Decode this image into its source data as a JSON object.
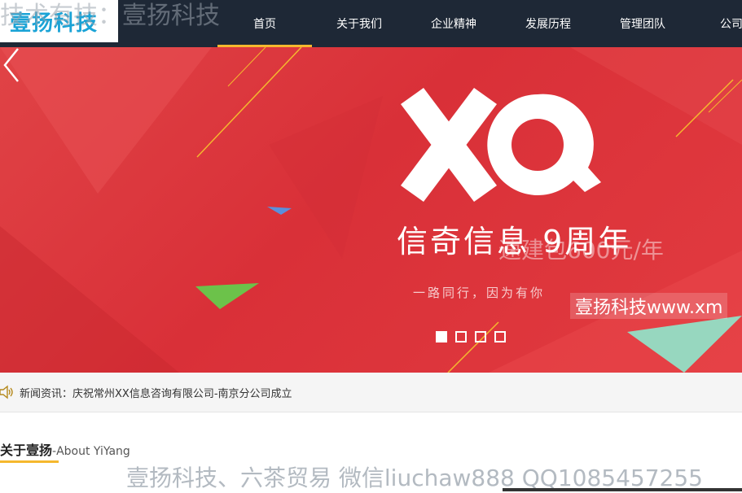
{
  "watermark": {
    "top": "技术有技：壹扬科技",
    "banner": "壹扬科技www.xm",
    "bottom": "壹扬科技、六茶贸易 微信liuchaw888 QQ1085457255"
  },
  "logo": {
    "text": "壹扬科技",
    "color": "#1aa3d6"
  },
  "nav": {
    "items": [
      {
        "label": "首页",
        "active": true
      },
      {
        "label": "关于我们"
      },
      {
        "label": "企业精神"
      },
      {
        "label": "发展历程"
      },
      {
        "label": "管理团队"
      },
      {
        "label": "公司动"
      }
    ]
  },
  "banner": {
    "brand": "XQ",
    "slogan": "信奇信息 9周年",
    "ghost_text": "速建包600元/年",
    "subline": "一路同行，因为有你",
    "dots": 4,
    "active_dot": 0
  },
  "news": {
    "label": "新闻资讯：",
    "text": "庆祝常州XX信息咨询有限公司-南京分公司成立"
  },
  "about": {
    "title": "关于壹扬",
    "subtitle": "-About YiYang"
  },
  "colors": {
    "header_bg": "#1e2836",
    "accent": "#f5b82e",
    "banner_red": "#dc353b"
  }
}
